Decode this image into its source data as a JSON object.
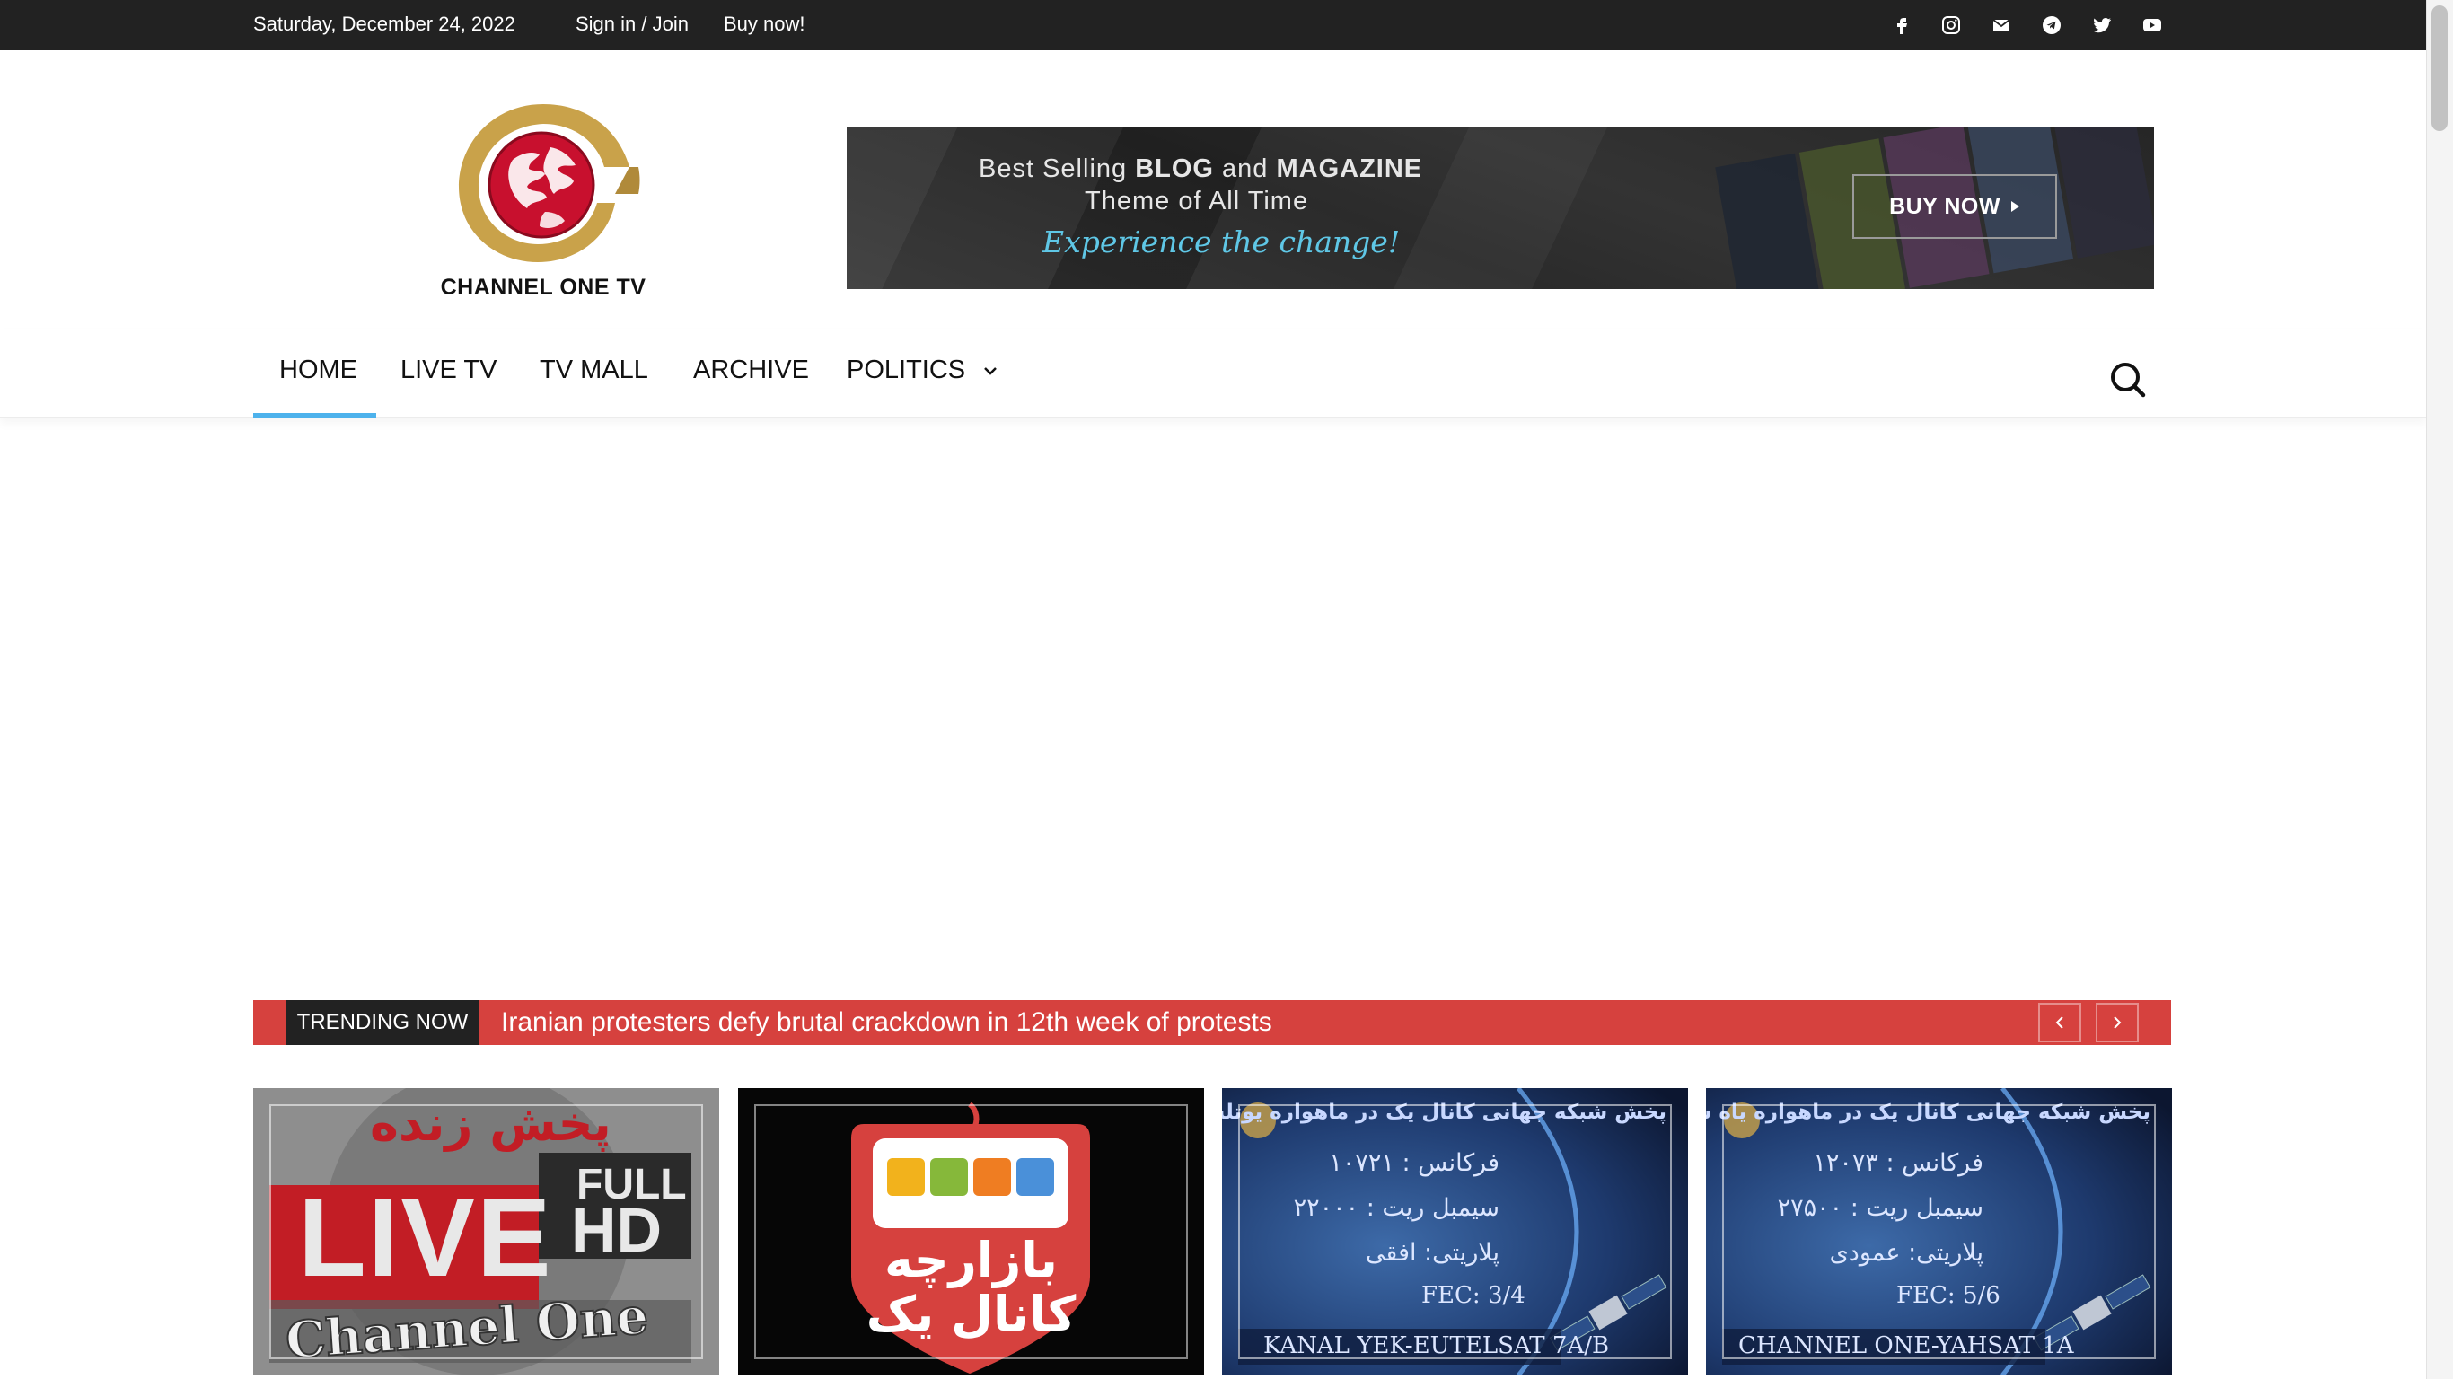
{
  "topbar": {
    "date": "Saturday, December 24, 2022",
    "signin": "Sign in / Join",
    "buy": "Buy now!",
    "social": [
      "facebook-icon",
      "instagram-icon",
      "mail-icon",
      "telegram-icon",
      "twitter-icon",
      "youtube-icon"
    ]
  },
  "logo": {
    "name": "CHANNEL ONE TV"
  },
  "banner": {
    "line1_a": "Best Selling ",
    "line1_b": "BLOG",
    "line1_c": " and ",
    "line1_d": "MAGAZINE",
    "line2": "Theme of All Time",
    "line3": "Experience the change!",
    "button": "BUY NOW"
  },
  "nav": {
    "items": [
      "HOME",
      "LIVE TV",
      "TV MALL",
      "ARCHIVE",
      "POLITICS"
    ],
    "active": "HOME"
  },
  "trending": {
    "label": "TRENDING NOW",
    "headline": "Iranian protesters defy brutal crackdown in 12th week of protests"
  },
  "thumbs": {
    "t1": {
      "top": "پخش زنده",
      "live": "LIVE",
      "full": "FULL",
      "hd": "HD",
      "bottom": "Channel One HD"
    },
    "t2": {
      "line1": "بازارچه",
      "line2": "کانال یک"
    },
    "t3": {
      "title": "پخش شبکه جهانی کانال یک در ماهواره یوتلست",
      "freq": "فرکانس : ۱۰۷۲۱",
      "symbol": "سیمبل ریت : ۲۲۰۰۰",
      "pol": "پلاریتی: افقی",
      "fec": "FEC: 3/4",
      "footer": "KANAL YEK-EUTELSAT 7A/B"
    },
    "t4": {
      "title": "پخش شبکه جهانی کانال یک در ماهواره یاه ست",
      "freq": "فرکانس : ۱۲۰۷۳",
      "symbol": "سیمبل ریت : ۲۷۵۰۰",
      "pol": "پلاریتی: عمودی",
      "fec": "FEC: 5/6",
      "footer": "CHANNEL ONE-YAHSAT 1A"
    }
  },
  "colors": {
    "topbar": "#222222",
    "accent": "#4db2ec",
    "trending": "#d6413e",
    "logo_gold": "#c9a24a",
    "logo_red": "#c8102e"
  }
}
